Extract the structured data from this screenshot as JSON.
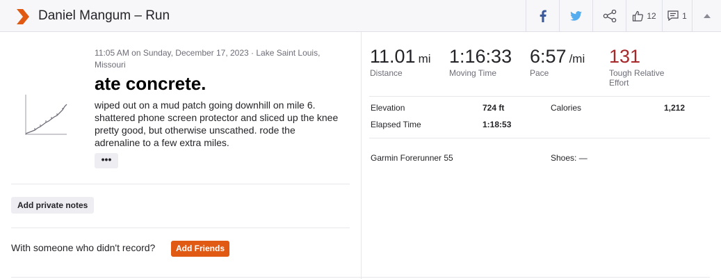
{
  "header": {
    "title": "Daniel Mangum – Run",
    "kudos_count": "12",
    "comments_count": "1",
    "icons": {
      "logo": "strava-chevron-icon",
      "facebook": "facebook-icon",
      "twitter": "twitter-icon",
      "share": "share-icon",
      "kudos": "thumbs-up-icon",
      "comment": "comment-icon",
      "collapse": "caret-up-icon"
    }
  },
  "activity": {
    "meta": "11:05 AM on Sunday, December 17, 2023 · Lake Saint Louis, Missouri",
    "title": "ate concrete.",
    "description": "wiped out on a mud patch going downhill on mile 6. shattered phone screen protector and sliced up the knee pretty good, but otherwise unscathed. rode the adrenaline to a few extra miles.",
    "more_label": "•••",
    "private_notes_label": "Add private notes",
    "with_someone_text": "With someone who didn't record?",
    "add_friends_label": "Add Friends"
  },
  "stats": [
    {
      "value": "11.01",
      "unit": "mi",
      "label": "Distance"
    },
    {
      "value": "1:16:33",
      "unit": "",
      "label": "Moving Time"
    },
    {
      "value": "6:57",
      "unit": "/mi",
      "label": "Pace"
    },
    {
      "value": "131",
      "unit": "",
      "label": "Tough Relative Effort"
    }
  ],
  "details": {
    "elevation_label": "Elevation",
    "elevation_value": "724 ft",
    "calories_label": "Calories",
    "calories_value": "1,212",
    "elapsed_label": "Elapsed Time",
    "elapsed_value": "1:18:53",
    "device": "Garmin Forerunner 55",
    "shoes": "Shoes: —"
  },
  "colors": {
    "brand_orange": "#e05a13",
    "effort_red": "#a5282b",
    "facebook": "#3b5998",
    "twitter": "#55acee"
  }
}
